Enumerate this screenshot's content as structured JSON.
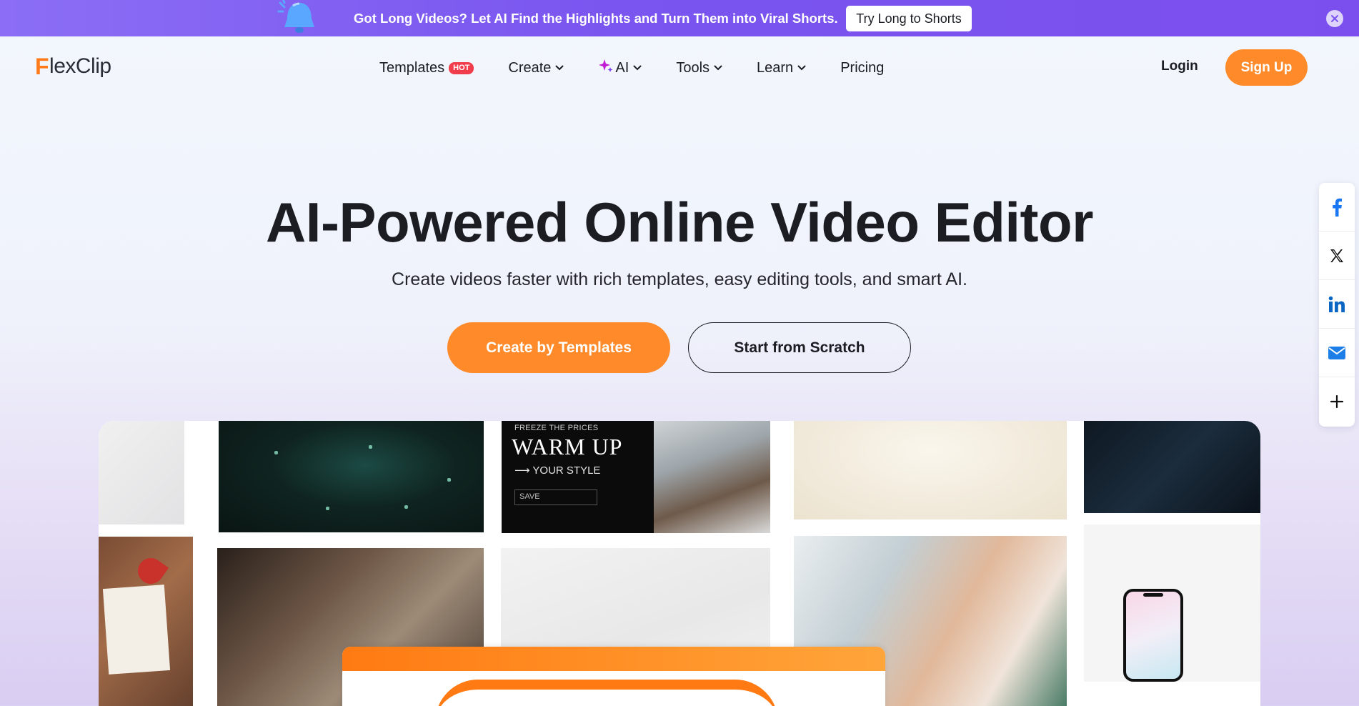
{
  "banner": {
    "message": "Got Long Videos? Let AI Find the Highlights and Turn Them into Viral Shorts.",
    "cta": "Try Long to Shorts",
    "close_icon": "close-icon",
    "bell_icon": "bell-icon"
  },
  "nav": {
    "logo": {
      "first": "F",
      "rest": "lexClip"
    },
    "items": [
      {
        "label": "Templates",
        "badge": "HOT",
        "dropdown": false
      },
      {
        "label": "Create",
        "dropdown": true
      },
      {
        "label": "AI",
        "dropdown": true,
        "icon": "sparkle-icon"
      },
      {
        "label": "Tools",
        "dropdown": true
      },
      {
        "label": "Learn",
        "dropdown": true
      },
      {
        "label": "Pricing",
        "dropdown": false
      }
    ],
    "login": "Login",
    "signup": "Sign Up"
  },
  "hero": {
    "title": "AI-Powered Online Video Editor",
    "subtitle": "Create videos faster with rich templates, easy editing tools, and smart AI.",
    "primary_button": "Create by Templates",
    "secondary_button": "Start from Scratch"
  },
  "showcase": {
    "promo_tile": {
      "kicker": "FREEZE THE PRICES",
      "headline": "WARM UP",
      "tagline": "⟶ YOUR STYLE",
      "field": "SAVE"
    }
  },
  "share": {
    "items": [
      "facebook-icon",
      "x-icon",
      "linkedin-icon",
      "email-icon",
      "plus-icon"
    ]
  },
  "colors": {
    "accent": "#ff8a2a",
    "banner": "#7b55ef",
    "hot_badge": "#f03c4b",
    "facebook": "#1877f2",
    "linkedin": "#0a66c2"
  }
}
